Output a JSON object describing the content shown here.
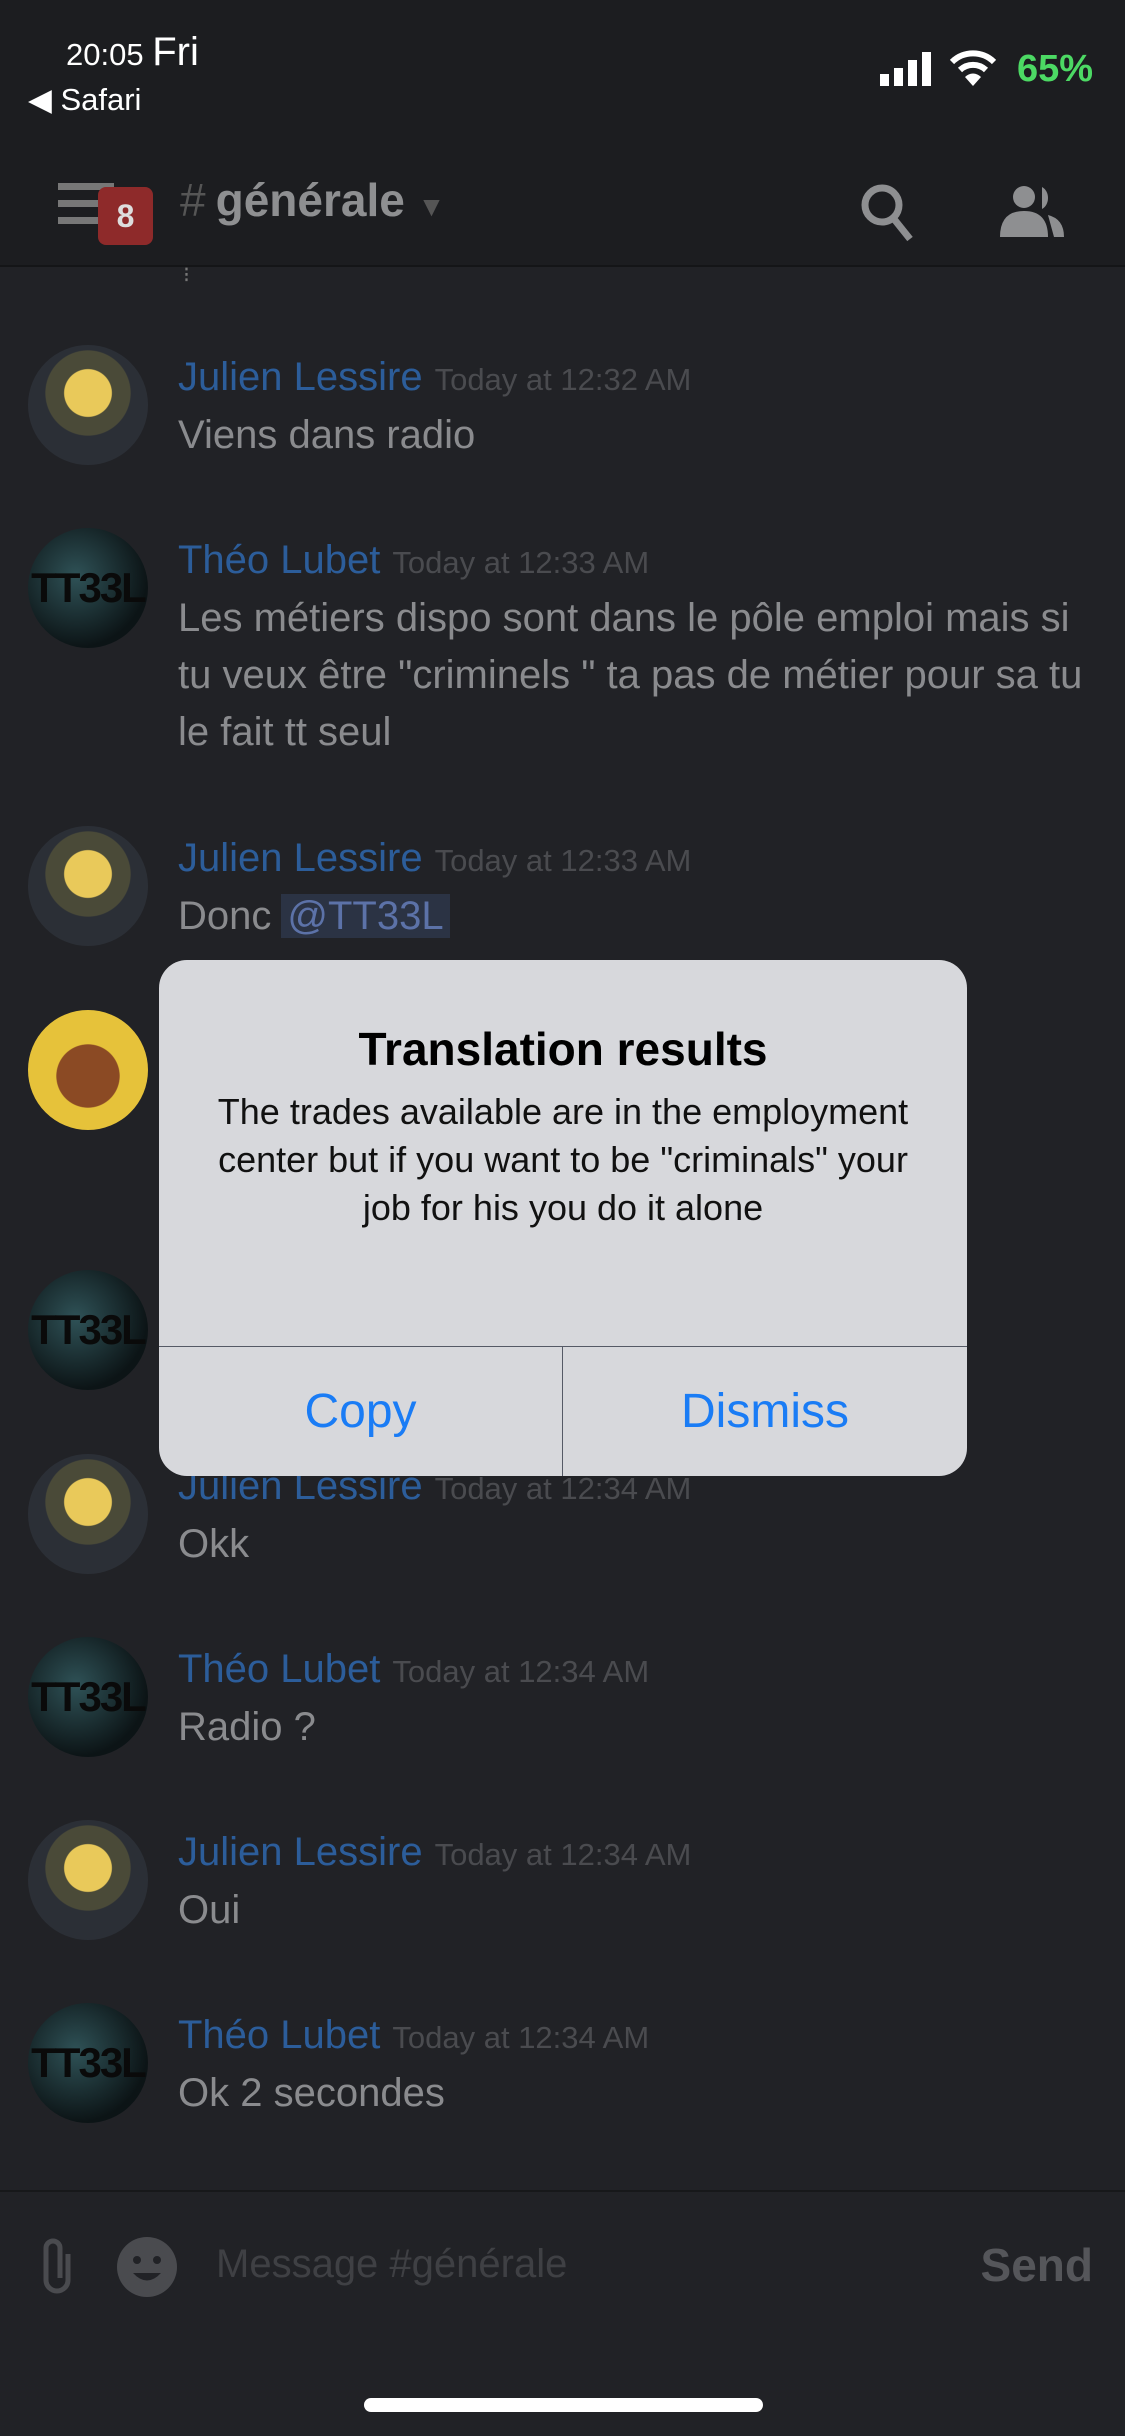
{
  "status_bar": {
    "time": "20:05",
    "day": "Fri",
    "back_app": "Safari",
    "battery": "65%"
  },
  "header": {
    "channel": "générale",
    "hash": "#",
    "unread_badge": "8"
  },
  "messages": [
    {
      "author": "Julien Lessire",
      "timestamp": "Today at 12:32 AM",
      "text": "Viens dans radio"
    },
    {
      "author": "Théo Lubet",
      "timestamp": "Today at 12:33 AM",
      "text": "Les métiers dispo sont dans le pôle emploi mais si tu veux être \"criminels \" ta pas de métier pour sa tu le fait tt seul"
    },
    {
      "author": "Julien Lessire",
      "timestamp": "Today at 12:33 AM",
      "text": "Donc",
      "mention": "@TT33L"
    },
    {
      "author": "Julien Lessire",
      "timestamp": "Today at 12:34 AM",
      "text": "Okk"
    },
    {
      "author": "Théo Lubet",
      "timestamp": "Today at 12:34 AM",
      "text": "Radio ?"
    },
    {
      "author": "Julien Lessire",
      "timestamp": "Today at 12:34 AM",
      "text": "Oui"
    },
    {
      "author": "Théo Lubet",
      "timestamp": "Today at 12:34 AM",
      "text": "Ok 2 secondes"
    }
  ],
  "avatar_text": "TT33L",
  "dialog": {
    "title": "Translation results",
    "body": "The trades available are in the employment center but if you want to be \"criminals\" your job for his you do it alone",
    "copy": "Copy",
    "dismiss": "Dismiss"
  },
  "input": {
    "placeholder": "Message #générale",
    "send": "Send"
  }
}
